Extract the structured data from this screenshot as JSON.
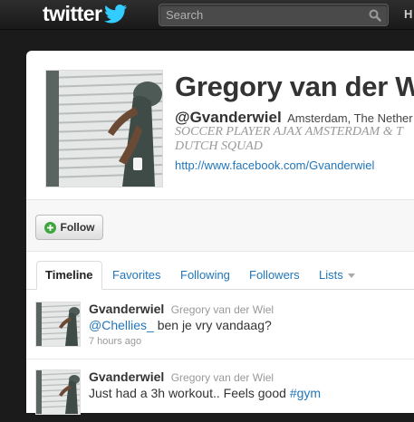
{
  "header": {
    "logo_text": "twitter",
    "search": {
      "placeholder": "Search"
    },
    "nav_home_label": "H"
  },
  "profile": {
    "name": "Gregory van der W",
    "screen_name": "@Gvanderwiel",
    "location": "Amsterdam, The Nether",
    "bio": "SOCCER PLAYER AJAX AMSTERDAM & T\nDUTCH SQUAD",
    "url": "http://www.facebook.com/Gvanderwiel",
    "follow_label": "Follow"
  },
  "tabs": [
    {
      "label": "Timeline",
      "active": true
    },
    {
      "label": "Favorites"
    },
    {
      "label": "Following"
    },
    {
      "label": "Followers"
    },
    {
      "label": "Lists"
    }
  ],
  "tweets": [
    {
      "user": "Gvanderwiel",
      "full_name": "Gregory van der Wiel",
      "mention": "@Chellies_",
      "text_after": " ben je vry vandaag?",
      "time": "7 hours ago"
    },
    {
      "user": "Gvanderwiel",
      "full_name": "Gregory van der Wiel",
      "text_before": "Just had a 3h workout.. Feels good ",
      "hashtag": "#gym"
    }
  ],
  "colors": {
    "link": "#2276bb",
    "topbar": "#1f1f1f",
    "bird": "#33ccff",
    "follow_icon": "#3ea63e"
  }
}
